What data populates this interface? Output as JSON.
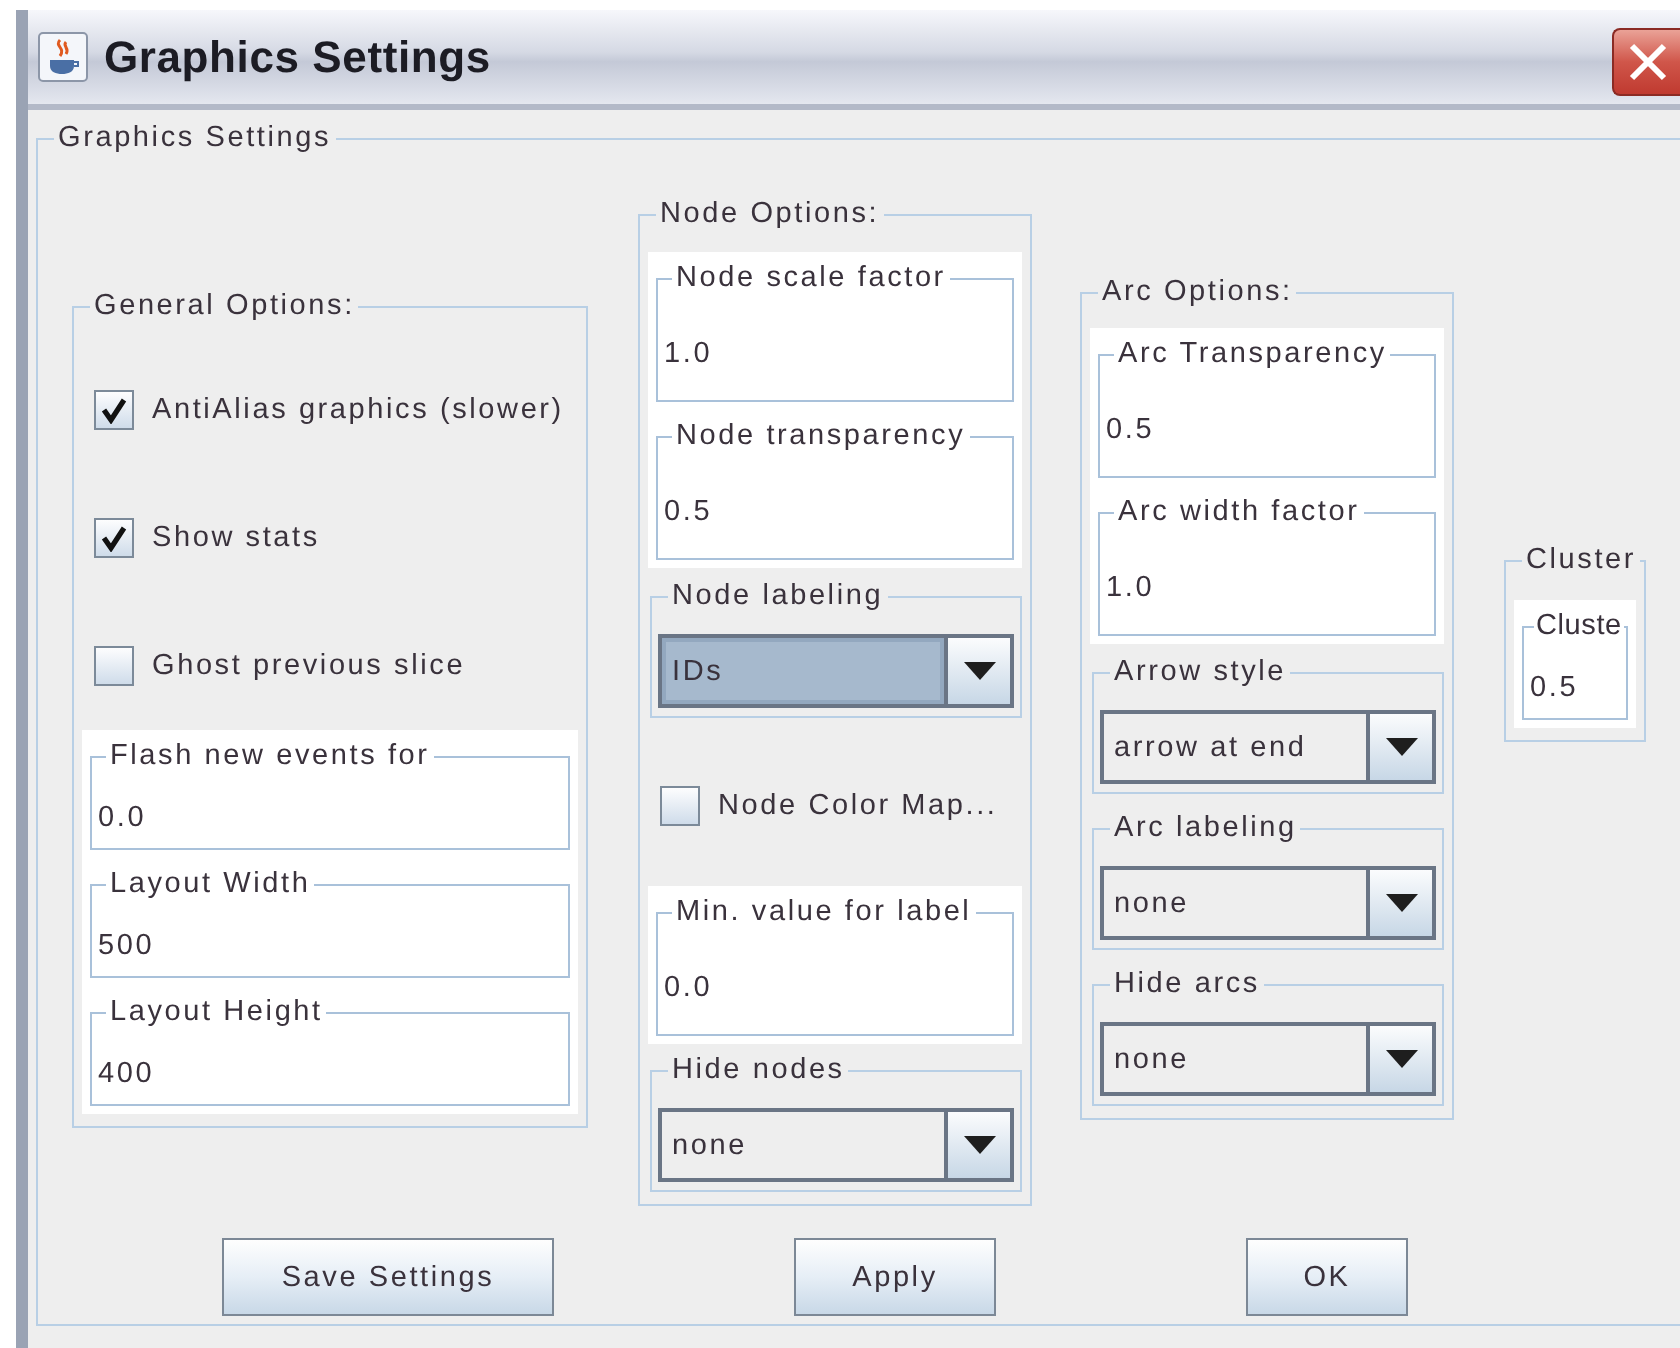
{
  "window": {
    "title": "Graphics Settings"
  },
  "settings_panel": {
    "title": "Graphics Settings",
    "groups": [
      {
        "title": "General Options:",
        "items": [
          {
            "kind": "checkbox",
            "label": "AntiAlias graphics (slower)",
            "checked": true
          },
          {
            "kind": "checkbox",
            "label": "Show stats",
            "checked": true
          },
          {
            "kind": "checkbox",
            "label": "Ghost previous slice",
            "checked": false
          },
          {
            "kind": "fields",
            "fields": [
              {
                "label": "Flash new events for",
                "value": "0.0"
              },
              {
                "label": "Layout Width",
                "value": "500"
              },
              {
                "label": "Layout Height",
                "value": "400"
              }
            ]
          }
        ]
      },
      {
        "title": "Node Options:",
        "items": [
          {
            "kind": "fields",
            "fields": [
              {
                "label": "Node scale factor",
                "value": "1.0"
              },
              {
                "label": "Node transparency",
                "value": "0.5"
              }
            ]
          },
          {
            "kind": "dropdown",
            "label": "Node labeling",
            "value": "IDs",
            "focused": true
          },
          {
            "kind": "checkbox",
            "label": "Node Color Map...",
            "checked": false
          },
          {
            "kind": "fields",
            "fields": [
              {
                "label": "Min. value for label",
                "value": "0.0"
              }
            ]
          },
          {
            "kind": "dropdown",
            "label": "Hide nodes",
            "value": "none",
            "focused": false
          }
        ]
      },
      {
        "title": "Arc Options:",
        "items": [
          {
            "kind": "fields",
            "fields": [
              {
                "label": "Arc Transparency",
                "value": "0.5"
              },
              {
                "label": "Arc width factor",
                "value": "1.0"
              }
            ]
          },
          {
            "kind": "dropdown",
            "label": "Arrow style",
            "value": "arrow at end",
            "focused": false
          },
          {
            "kind": "dropdown",
            "label": "Arc labeling",
            "value": "none",
            "focused": false
          },
          {
            "kind": "dropdown",
            "label": "Hide arcs",
            "value": "none",
            "focused": false
          }
        ]
      },
      {
        "title": "Cluster",
        "items": [
          {
            "kind": "fields",
            "fields": [
              {
                "label": "Cluste",
                "value": "0.5"
              }
            ]
          }
        ]
      }
    ]
  },
  "buttons": [
    "Save Settings",
    "Apply",
    "OK"
  ]
}
